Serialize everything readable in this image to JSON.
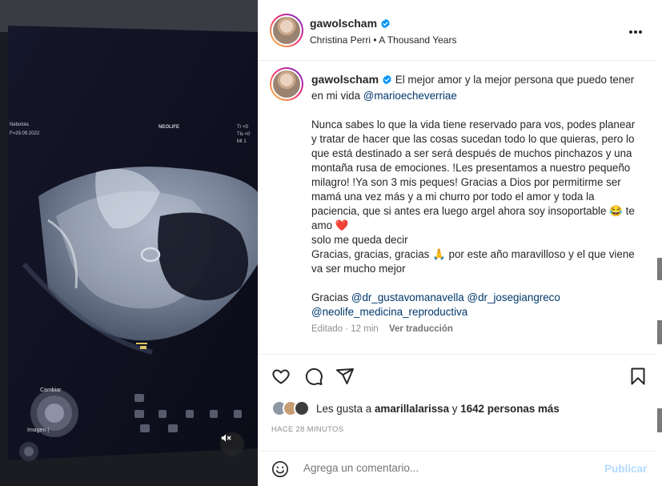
{
  "header": {
    "username": "gawolscham",
    "music_artist": "Christina Perri",
    "music_separator": "•",
    "music_title": "A Thousand Years",
    "more_icon": "more-horizontal-icon"
  },
  "video": {
    "screen_header_left": "Nebolola",
    "screen_date": "F=29.09.2022",
    "screen_brand": "NEOLIFE",
    "screen_corner_1": "Tr <0",
    "screen_corner_2": "Tls <0",
    "screen_corner_3": "MI 1",
    "button_label": "Cambiar",
    "image_label": "Imagen |",
    "mute_icon": "speaker-muted-icon"
  },
  "caption": {
    "username": "gawolscham",
    "intro": "El mejor amor y la mejor persona que puedo tener en mi vida",
    "intro_mention": "@marioecheverriae",
    "body_line1": "Nunca sabes lo que la vida tiene reservado para vos, podes planear y tratar de hacer que las cosas sucedan todo lo que quieras, pero lo que está destinado a ser será después de muchos pinchazos y una montaña rusa de emociones. !Les presentamos a nuestro pequeño milagro! !Ya son 3 mis peques! Gracias a Dios por permitirme ser mamá una vez más y a mi churro por todo el amor y toda la paciencia, que si antes era luego argel ahora soy insoportable",
    "body_emoji1": "😂",
    "body_after_emoji1": "te amo",
    "body_emoji2": "❤️",
    "line_queda": "solo me queda decir",
    "line_gracias_a": "Gracias, gracias, gracias",
    "line_gracias_emoji": "🙏",
    "line_gracias_b": "por este año maravilloso y el que viene va ser mucho mejor",
    "thanks_word": "Gracias",
    "mention1": "@dr_gustavomanavella",
    "mention2": "@dr_josegiangreco",
    "mention3": "@neolife_medicina_reproductiva",
    "edited_label": "Editado",
    "edited_sep": "·",
    "edited_time": "12 min",
    "translate_label": "Ver traducción"
  },
  "actions": {
    "like_icon": "heart-icon",
    "comment_icon": "comment-icon",
    "share_icon": "send-icon",
    "save_icon": "bookmark-icon",
    "likes_prefix": "Les gusta a",
    "likes_user": "amarillalarissa",
    "likes_middle": "y",
    "likes_count": "1642 personas más",
    "time_ago": "HACE 28 MINUTOS"
  },
  "comment": {
    "emoji_icon": "emoji-icon",
    "placeholder": "Agrega un comentario...",
    "publish_label": "Publicar"
  },
  "colors": {
    "text": "#262626",
    "muted": "#8e8e8e",
    "mention": "#00376b",
    "verified": "#0095f6",
    "publish_disabled": "#b3dbff",
    "heart": "#ed4956"
  }
}
